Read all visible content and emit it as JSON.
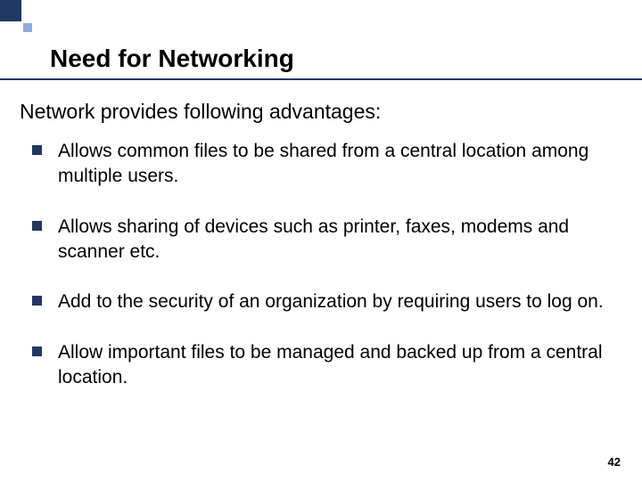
{
  "slide": {
    "title": "Need for Networking",
    "intro": "Network provides following advantages:",
    "bullets": [
      "Allows common files to be shared from a central location among multiple users.",
      "Allows sharing of devices such as printer, faxes, modems and scanner etc.",
      "Add to the security of an organization by requiring users to log on.",
      "Allow important files to be managed and backed up from a central location."
    ],
    "page_number": "42"
  }
}
